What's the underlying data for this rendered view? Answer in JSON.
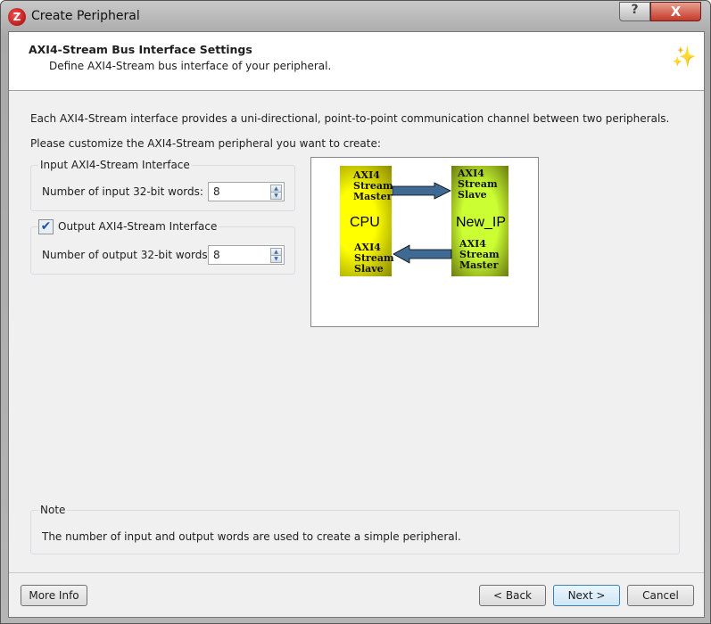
{
  "window": {
    "title": "Create Peripheral",
    "help_label": "?",
    "close_label": "X"
  },
  "header": {
    "title": "AXI4-Stream Bus Interface Settings",
    "subtitle": "Define AXI4-Stream bus interface of your peripheral."
  },
  "body": {
    "description": "Each AXI4-Stream interface provides a uni-directional, point-to-point communication channel between two peripherals.",
    "prompt": "Please customize the AXI4-Stream peripheral you want to create:",
    "input_group": {
      "title": "Input AXI4-Stream Interface",
      "label": "Number of input 32-bit words:",
      "value": "8"
    },
    "output_group": {
      "title": "Output AXI4-Stream Interface",
      "checked": true,
      "label": "Number of output 32-bit words:",
      "value": "8"
    }
  },
  "diagram": {
    "cpu": {
      "name": "CPU",
      "top_port": [
        "AXI4",
        "Stream",
        "Master"
      ],
      "bottom_port": [
        "AXI4",
        "Stream",
        "Slave"
      ],
      "color": "#ffff00"
    },
    "ip": {
      "name": "New_IP",
      "top_port": [
        "AXI4",
        "Stream",
        "Slave"
      ],
      "bottom_port": [
        "AXI4",
        "Stream",
        "Master"
      ],
      "color": "#ccff33"
    },
    "arrow_color": "#3f6a94"
  },
  "note": {
    "title": "Note",
    "text": "The number of input and output words are used to create a simple peripheral."
  },
  "buttons": {
    "more_info": "More Info",
    "back": "< Back",
    "next": "Next >",
    "cancel": "Cancel"
  }
}
